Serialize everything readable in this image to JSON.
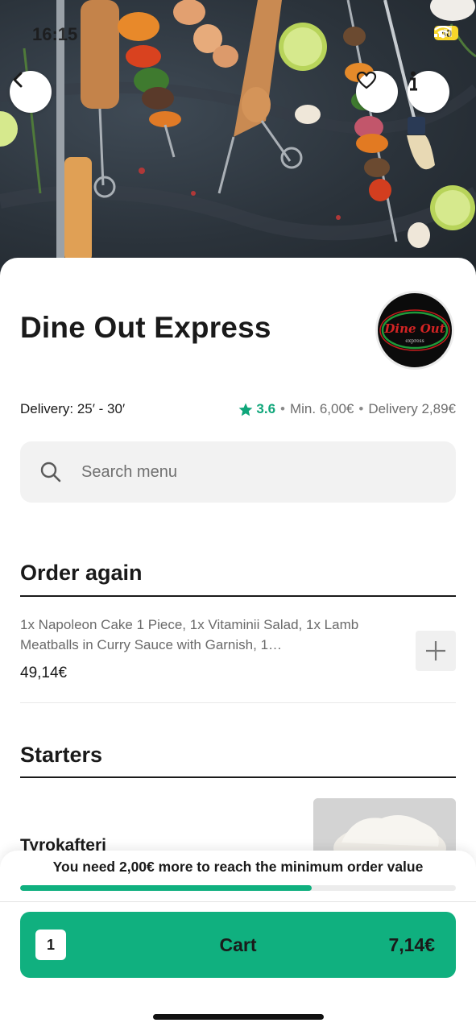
{
  "status_bar": {
    "time": "16:15",
    "battery": "40"
  },
  "restaurant": {
    "name": "Dine Out Express",
    "logo_text": "Dine Out",
    "logo_subtext": "express",
    "delivery_time": "Delivery: 25′ - 30′",
    "rating": "3.6",
    "min_order": "Min. 6,00€",
    "delivery_fee": "Delivery 2,89€",
    "separator": "•"
  },
  "search": {
    "placeholder": "Search menu"
  },
  "order_again": {
    "title": "Order again",
    "description": "1x Napoleon Cake 1 Piece, 1x Vitaminii Salad, 1x Lamb Meatballs in Curry Sauce with Garnish, 1…",
    "price": "49,14€"
  },
  "starters": {
    "title": "Starters",
    "items": [
      {
        "name": "Tyrokafteri"
      }
    ]
  },
  "minimum_order": {
    "message": "You need 2,00€ more to reach the minimum order value",
    "progress_percent": 67
  },
  "cart": {
    "count": "1",
    "label": "Cart",
    "total": "7,14€"
  },
  "colors": {
    "accent": "#10b07f",
    "rating": "#0fa67a"
  },
  "icons": {
    "back": "chevron-left-icon",
    "favorite": "heart-icon",
    "info": "info-icon",
    "search": "search-icon",
    "add": "plus-icon",
    "rating": "star-icon"
  }
}
